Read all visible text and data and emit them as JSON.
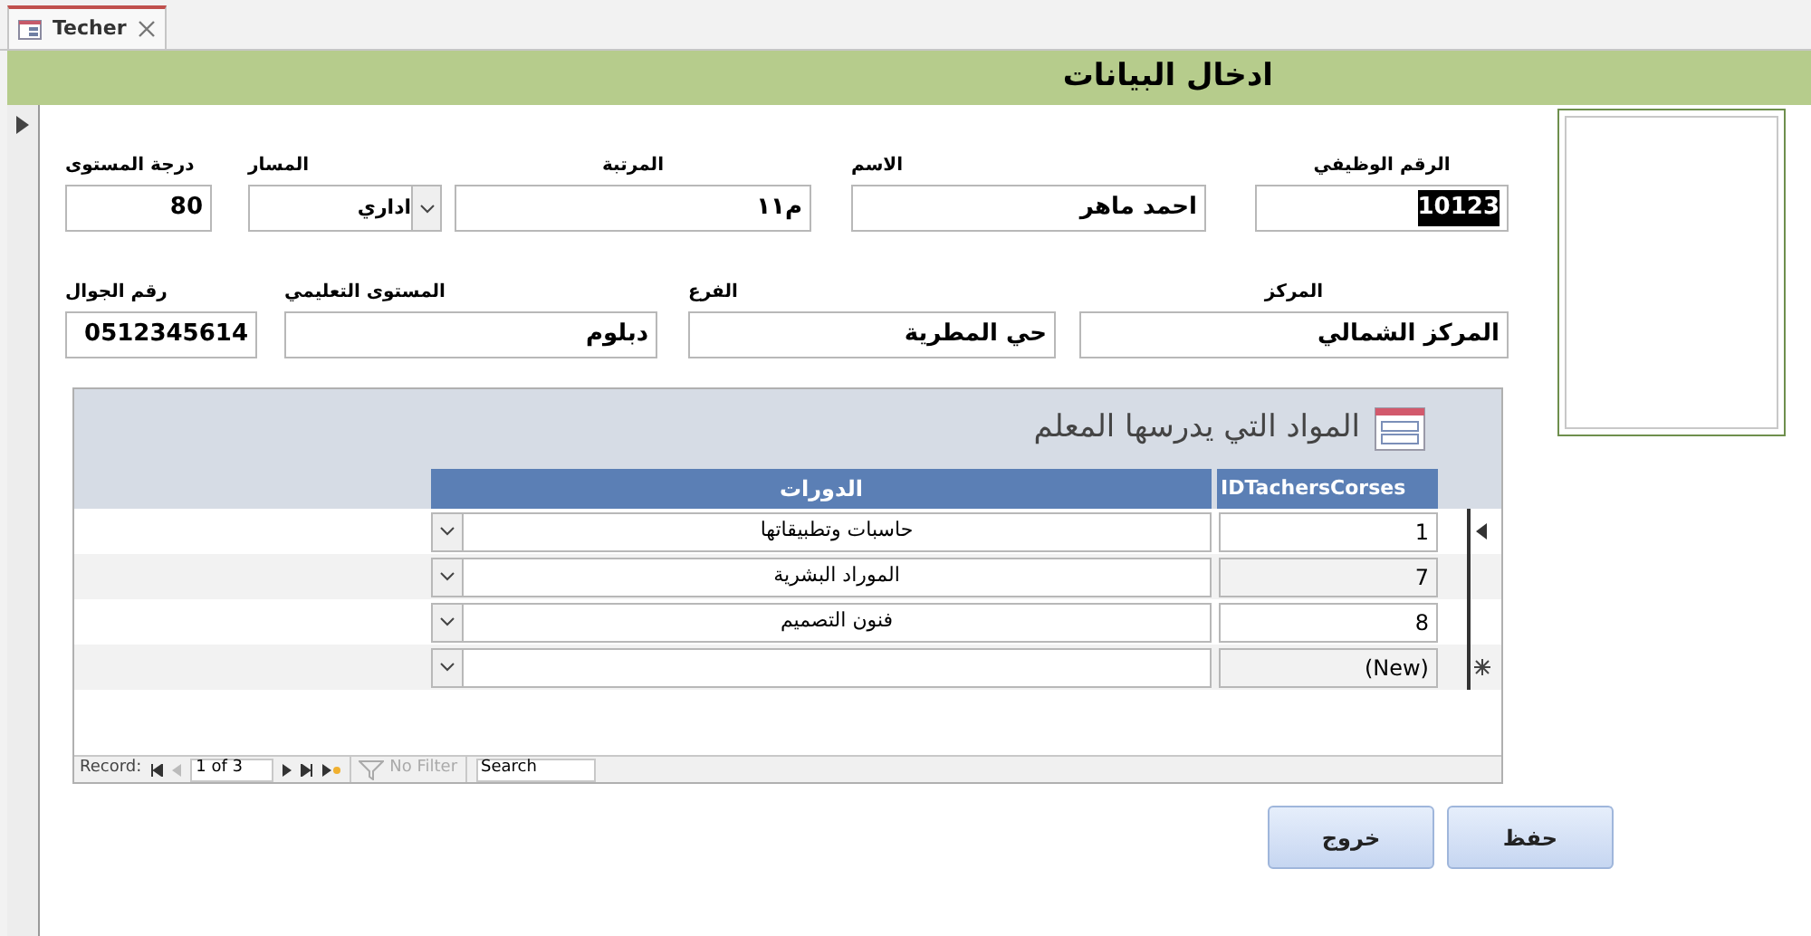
{
  "tab": {
    "title": "Techer"
  },
  "header": {
    "title": "ادخال البيانات"
  },
  "fields_row_1": [
    {
      "label": "الرقم الوظيفي",
      "value": "10123",
      "kind": "text",
      "highlighted": true
    },
    {
      "label": "الاسم",
      "value": "احمد ماهر",
      "kind": "text",
      "highlighted": false
    },
    {
      "label": "المرتبة",
      "value": "م١١",
      "kind": "text",
      "highlighted": false
    },
    {
      "label": "المسار",
      "value": "اداري",
      "kind": "combo",
      "highlighted": false
    },
    {
      "label": "درجة المستوى",
      "value": "80",
      "kind": "text",
      "highlighted": false
    }
  ],
  "fields_row_2": [
    {
      "label": "المركز",
      "value": "المركز الشمالي",
      "kind": "text",
      "highlighted": false
    },
    {
      "label": "الفرع",
      "value": "حي المطرية",
      "kind": "text",
      "highlighted": false
    },
    {
      "label": "المستوى التعليمي",
      "value": "دبلوم",
      "kind": "text",
      "highlighted": false
    },
    {
      "label": "رقم الجوال",
      "value": "0512345614",
      "kind": "text",
      "highlighted": false
    }
  ],
  "subform": {
    "title": "المواد التي يدرسها المعلم",
    "columns": [
      "IDTachersCorses",
      "الدورات"
    ],
    "rows": [
      {
        "id": "1",
        "course": "حاسبات وتطبيقاتها",
        "kind": "current"
      },
      {
        "id": "7",
        "course": "الموراد البشرية",
        "kind": "record"
      },
      {
        "id": "8",
        "course": "فنون التصميم",
        "kind": "record"
      },
      {
        "id": "(New)",
        "course": "",
        "kind": "new"
      }
    ],
    "navigation": {
      "label": "Record:",
      "position": "1 of 3",
      "filter": "No Filter",
      "search": "Search"
    }
  },
  "buttons": [
    "حفظ",
    "خروج"
  ]
}
